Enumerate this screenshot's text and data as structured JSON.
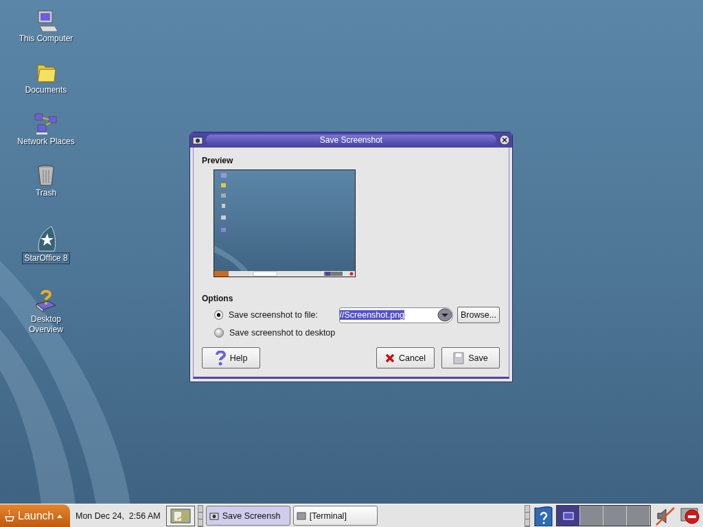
{
  "desktop_icons": [
    {
      "label": "This Computer",
      "focused": false
    },
    {
      "label": "Documents",
      "focused": false
    },
    {
      "label": "Network Places",
      "focused": false
    },
    {
      "label": "Trash",
      "focused": false
    },
    {
      "label": "StarOffice 8",
      "focused": true
    },
    {
      "label": "Desktop\nOverview",
      "focused": false
    }
  ],
  "dialog": {
    "title": "Save Screenshot",
    "preview_heading": "Preview",
    "options_heading": "Options",
    "options": [
      {
        "label": "Save screenshot to file:",
        "selected": true
      },
      {
        "label": "Save screenshot to desktop",
        "selected": false
      }
    ],
    "filename": {
      "value": "//Screenshot.png",
      "text_selected": true
    },
    "browse_button": "Browse...",
    "help_button": "Help",
    "cancel_button": "Cancel",
    "save_button": "Save"
  },
  "taskbar": {
    "launch": "Launch",
    "clock": "Mon Dec 24,  2:56 AM",
    "tasks": [
      {
        "label": "Save Screensh",
        "selected": true
      },
      {
        "label": "[Terminal]",
        "selected": false
      }
    ],
    "workspaces": [
      {
        "selected": true
      },
      {
        "selected": false
      },
      {
        "selected": false
      },
      {
        "selected": false
      }
    ],
    "sound_muted": true
  }
}
